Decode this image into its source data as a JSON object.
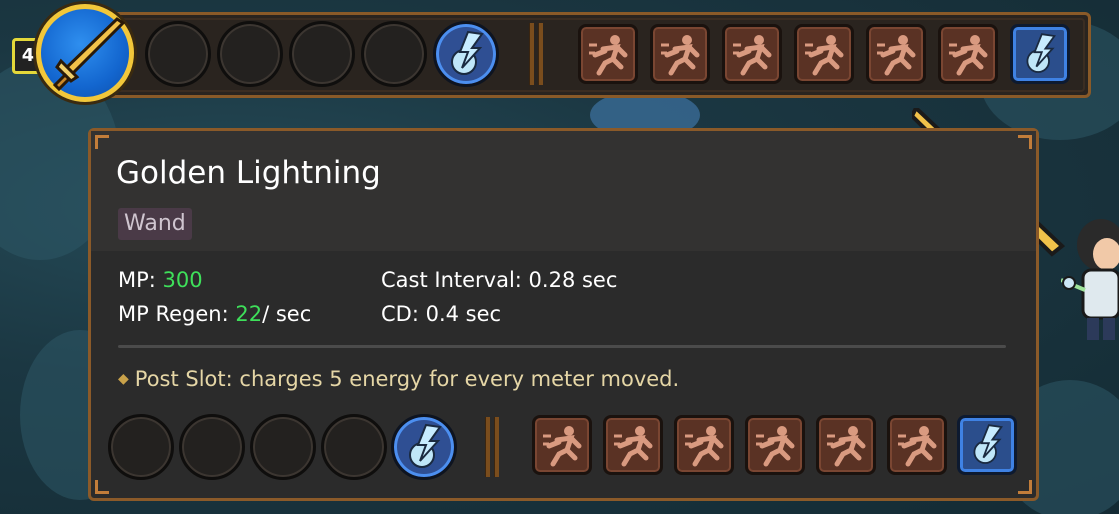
{
  "hud": {
    "level_badge": "4"
  },
  "top_bar": {
    "wand_icon": "golden-wand-icon",
    "empty_slots": 4,
    "spell_slot_icon": "lightning-orb-icon",
    "passive_slots": [
      "run-icon",
      "run-icon",
      "run-icon",
      "run-icon",
      "run-icon",
      "run-icon",
      "lightning-orb-icon"
    ]
  },
  "tooltip": {
    "title": "Golden Lightning",
    "tag": "Wand",
    "stats": {
      "mp_label": "MP: ",
      "mp_value": "300",
      "regen_label": "MP Regen: ",
      "regen_value": "22",
      "regen_unit": "/ sec",
      "cast_interval": "Cast Interval: 0.28 sec",
      "cd": "CD: 0.4 sec"
    },
    "description": "Post Slot: charges 5 energy for every meter moved.",
    "slots": {
      "empty_slots": 4,
      "spell_slot_icon": "lightning-orb-icon",
      "passive_slots": [
        "run-icon",
        "run-icon",
        "run-icon",
        "run-icon",
        "run-icon",
        "run-icon",
        "lightning-orb-icon"
      ]
    }
  },
  "colors": {
    "panel_border": "#8b5a29",
    "stat_highlight": "#3ee05a",
    "description_text": "#e5d6a6",
    "tag_bg": "#4a3a47"
  }
}
